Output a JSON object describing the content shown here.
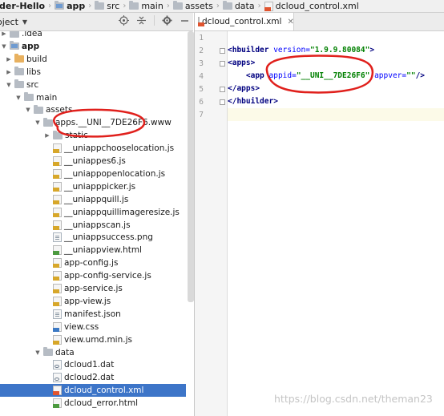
{
  "breadcrumb": {
    "items": [
      "der-Hello",
      "app",
      "src",
      "main",
      "assets",
      "data",
      "dcloud_control.xml"
    ]
  },
  "project": {
    "title": "oject",
    "tree": [
      {
        "label": ".idea",
        "icon": "folder-icon",
        "arrow": "right"
      },
      {
        "label": "app",
        "icon": "module-folder-icon",
        "arrow": "down",
        "bold": true
      },
      {
        "label": "build",
        "icon": "orange-folder-icon",
        "arrow": "right"
      },
      {
        "label": "libs",
        "icon": "folder-icon",
        "arrow": "right"
      },
      {
        "label": "src",
        "icon": "folder-icon",
        "arrow": "down"
      },
      {
        "label": "main",
        "icon": "folder-icon",
        "arrow": "down"
      },
      {
        "label": "assets",
        "icon": "folder-icon",
        "arrow": "down"
      },
      {
        "label": "apps.__UNI__7DE26F6.www",
        "icon": "folder-icon",
        "arrow": "down"
      },
      {
        "label": "static",
        "icon": "folder-icon",
        "arrow": "right"
      },
      {
        "label": "__uniappchooselocation.js",
        "icon": "js-file-icon"
      },
      {
        "label": "__uniappes6.js",
        "icon": "js-file-icon"
      },
      {
        "label": "__uniappopenlocation.js",
        "icon": "js-file-icon"
      },
      {
        "label": "__uniapppicker.js",
        "icon": "js-file-icon"
      },
      {
        "label": "__uniappquill.js",
        "icon": "js-file-icon"
      },
      {
        "label": "__uniappquillimageresize.js",
        "icon": "js-file-icon"
      },
      {
        "label": "__uniappscan.js",
        "icon": "js-file-icon"
      },
      {
        "label": "__uniappsuccess.png",
        "icon": "image-file-icon"
      },
      {
        "label": "__uniappview.html",
        "icon": "html-file-icon"
      },
      {
        "label": "app-config.js",
        "icon": "js-file-icon"
      },
      {
        "label": "app-config-service.js",
        "icon": "js-file-icon"
      },
      {
        "label": "app-service.js",
        "icon": "js-file-icon"
      },
      {
        "label": "app-view.js",
        "icon": "js-file-icon"
      },
      {
        "label": "manifest.json",
        "icon": "json-file-icon"
      },
      {
        "label": "view.css",
        "icon": "css-file-icon"
      },
      {
        "label": "view.umd.min.js",
        "icon": "js-file-icon"
      },
      {
        "label": "data",
        "icon": "folder-icon",
        "arrow": "down"
      },
      {
        "label": "dcloud1.dat",
        "icon": "dat-file-icon"
      },
      {
        "label": "dcloud2.dat",
        "icon": "dat-file-icon"
      },
      {
        "label": "dcloud_control.xml",
        "icon": "xml-file-icon",
        "selected": true
      },
      {
        "label": "dcloud_error.html",
        "icon": "html-file-icon"
      }
    ]
  },
  "editor": {
    "tab_label": "dcloud_control.xml",
    "line_numbers": [
      "1",
      "2",
      "3",
      "4",
      "5",
      "6",
      "7"
    ],
    "code": {
      "l2_tag": "<hbuilder",
      "l2_attr": " version=",
      "l2_val": "\"1.9.9.80084\"",
      "l2_end": ">",
      "l3": "<apps>",
      "l4_indent": "    ",
      "l4_tag": "<app",
      "l4_attr1": " appid=",
      "l4_val1": "\"__UNI__7DE26F6\"",
      "l4_attr2": " appver=",
      "l4_val2": "\"\"",
      "l4_end": "/>",
      "l5": "</apps>",
      "l6": "</hbuilder>"
    }
  },
  "watermark": "https://blog.csdn.net/theman23",
  "colors": {
    "selection": "#3d75c8",
    "annotation": "#e0201c"
  }
}
